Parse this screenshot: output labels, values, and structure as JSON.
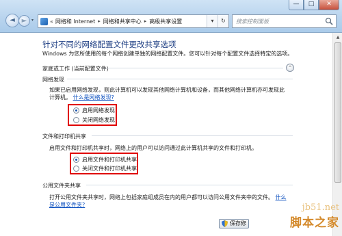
{
  "window": {
    "minimize_glyph": "—",
    "maximize_glyph": "□",
    "close_glyph": "✕"
  },
  "nav": {
    "back_glyph": "◄",
    "forward_glyph": "►"
  },
  "address": {
    "lead": "«",
    "crumbs": [
      "网络和 Internet",
      "网络和共享中心",
      "高级共享设置"
    ],
    "separator": "▸",
    "dropdown_glyph": "▾",
    "refresh_glyph": "↻"
  },
  "search": {
    "placeholder": "搜索控制面板"
  },
  "page": {
    "title": "针对不同的网络配置文件更改共享选项",
    "description": "Windows 为您所使用的每个网络创建单独的网络配置文件。您可以针对每个配置文件选择特定的选项。"
  },
  "profile": {
    "label": "家庭或工作 (当前配置文件)",
    "collapse_glyph": "⌃"
  },
  "network_discovery": {
    "heading": "网络发现",
    "text_line1": "如果已启用网络发现，则此计算机可以发现其他网络计算机和设备，而其他网络计算机亦可发现此",
    "text_line2": "计算机。",
    "link": "什么是网络发现?",
    "options": [
      {
        "label": "启用网络发现",
        "selected": true
      },
      {
        "label": "关闭网络发现",
        "selected": false
      }
    ]
  },
  "file_printer_sharing": {
    "heading": "文件和打印机共享",
    "text": "启用文件和打印机共享时，网络上的用户可以访问通过此计算机共享的文件和打印机。",
    "options": [
      {
        "label": "启用文件和打印机共享",
        "selected": true
      },
      {
        "label": "关闭文件和打印机共享",
        "selected": false
      }
    ]
  },
  "public_folder_sharing": {
    "heading": "公用文件夹共享",
    "text_line1": "打开公用文件夹共享时，网络上包括家庭组成员在内的用户都可以访问公用文件夹中的文件。",
    "link_part1": "什么",
    "link_line2": "是公用文件夹?"
  },
  "buttons": {
    "save": "保存修"
  },
  "watermark": {
    "url": "jb51.net",
    "name": "脚本之家"
  },
  "colors": {
    "highlight_box": "#e00000",
    "title": "#1b3c82",
    "link": "#0b4fbf"
  }
}
